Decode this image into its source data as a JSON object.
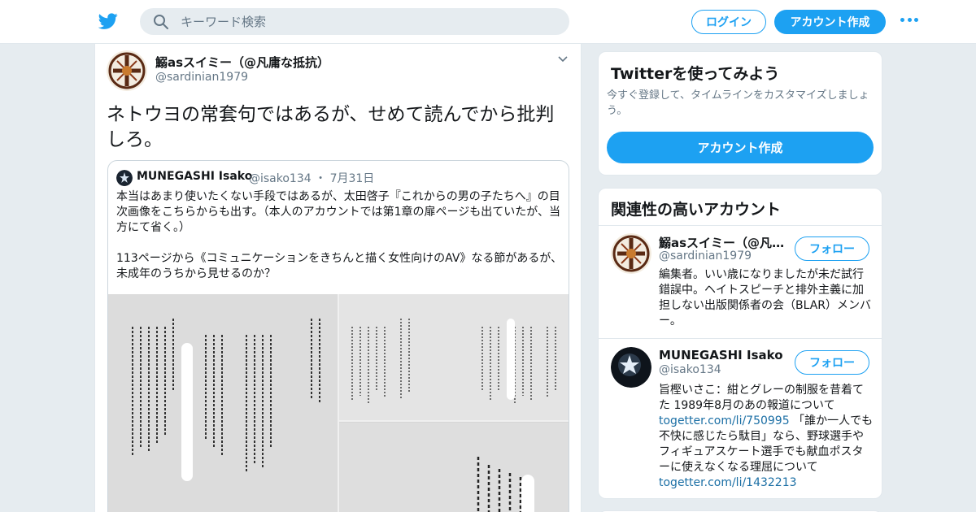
{
  "colors": {
    "brand": "#1da1f2",
    "link": "#1b6fa5",
    "muted": "#657786",
    "border": "#e1e8ed",
    "background": "#e6ecf0"
  },
  "header": {
    "logo_icon": "twitter-bird-icon",
    "search_placeholder": "キーワード検索",
    "login_label": "ログイン",
    "signup_label": "アカウント作成",
    "more_icon": "more-dots-icon"
  },
  "tweet": {
    "author_name": "鰯asスイミー（@凡庸な抵抗）",
    "author_handle": "@sardinian1979",
    "text": "ネトウヨの常套句ではあるが、せめて読んでから批判しろ。",
    "quote": {
      "author_name": "MUNEGASHI Isako",
      "author_handle": "@isako134",
      "separator": "・",
      "date": "7月31日",
      "text": "本当はあまり使いたくない手段ではあるが、太田啓子『これからの男の子たちへ』の目次画像をこちらからも出す。（本人のアカウントでは第1章の扉ページも出ていたが、当方にて省く。）\n\n113ページから《コミュニケーションをきちんと描く女性向けのAV》なる節があるが、未成年のうちから見せるのか？",
      "image_icon": "book-table-of-contents-image"
    }
  },
  "sidebar": {
    "signup_card": {
      "title": "Twitterを使ってみよう",
      "description": "今すぐ登録して、タイムラインをカスタマイズしましょう。",
      "cta_label": "アカウント作成"
    },
    "related": {
      "title": "関連性の高いアカウント",
      "accounts": [
        {
          "name": "鰯asスイミー（@凡庸な抵抗）",
          "handle": "@sardinian1979",
          "follow_label": "フォロー",
          "bio": "編集者。いい歳になりましたが未だ試行錯誤中。ヘイトスピーチと排外主義に加担しない出版関係者の会（BLAR）メンバー。"
        },
        {
          "name": "MUNEGASHI Isako",
          "handle": "@isako134",
          "follow_label": "フォロー",
          "bio_part1": "旨樫いさこ：紺とグレーの制服を昔着てた 1989年8月のあの報道について",
          "bio_link1": "togetter.com/li/750995",
          "bio_part2": "「誰か一人でも不快に感じたら駄目」なら、野球選手やフィギュアスケート選手でも献血ポスターに使えなくなる理屈について",
          "bio_link2": "togetter.com/li/1432213"
        }
      ]
    }
  }
}
